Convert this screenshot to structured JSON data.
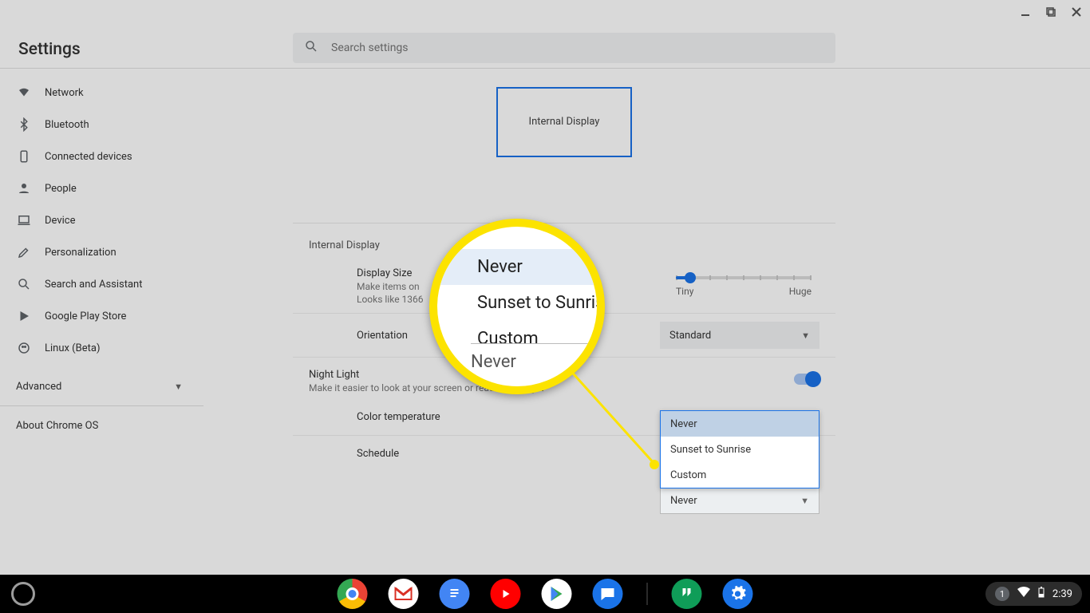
{
  "app_title": "Settings",
  "search": {
    "placeholder": "Search settings"
  },
  "window_controls": {
    "minimize": "minimize",
    "maximize": "maximize",
    "close": "close"
  },
  "sidebar": {
    "items": [
      {
        "label": "Network",
        "icon": "wifi-icon"
      },
      {
        "label": "Bluetooth",
        "icon": "bluetooth-icon"
      },
      {
        "label": "Connected devices",
        "icon": "phone-icon"
      },
      {
        "label": "People",
        "icon": "person-icon"
      },
      {
        "label": "Device",
        "icon": "laptop-icon"
      },
      {
        "label": "Personalization",
        "icon": "brush-icon"
      },
      {
        "label": "Search and Assistant",
        "icon": "search-icon"
      },
      {
        "label": "Google Play Store",
        "icon": "play-icon"
      },
      {
        "label": "Linux (Beta)",
        "icon": "linux-icon"
      }
    ],
    "advanced_label": "Advanced",
    "about_label": "About Chrome OS"
  },
  "display": {
    "preview_label": "Internal Display",
    "section_title": "Internal Display",
    "size": {
      "title": "Display Size",
      "line1": "Make items on",
      "line2": "Looks like 1366",
      "min_label": "Tiny",
      "max_label": "Huge"
    },
    "orientation": {
      "label": "Orientation",
      "value": "Standard"
    },
    "night_light": {
      "title": "Night Light",
      "subtitle": "Make it easier to look at your screen or read in dim light",
      "enabled": true,
      "color_temp_label": "Color temperature",
      "schedule_label": "Schedule",
      "schedule_value": "Never",
      "schedule_options": [
        "Never",
        "Sunset to Sunrise",
        "Custom"
      ]
    }
  },
  "callout": {
    "options": [
      "Never",
      "Sunset to Sunrise",
      "Custom"
    ],
    "selected": "Never",
    "current_field_value": "Never"
  },
  "taskbar": {
    "apps": [
      "chrome",
      "gmail",
      "docs",
      "youtube",
      "play-store",
      "messages",
      "hangouts",
      "settings"
    ],
    "tray": {
      "notification_count": "1",
      "time": "2:39"
    }
  },
  "colors": {
    "accent": "#1a73e8",
    "highlight": "#fce300"
  }
}
